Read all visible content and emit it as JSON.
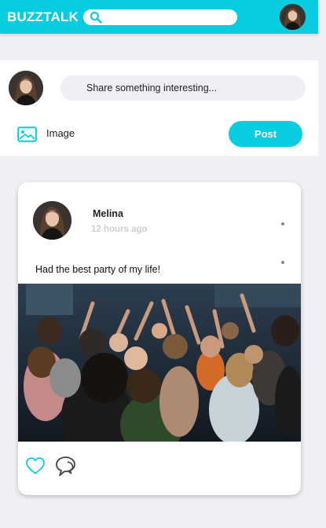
{
  "header": {
    "brand": "BUZZTALK",
    "search": {
      "value": "",
      "placeholder": ""
    },
    "icons": {
      "search": "search-icon",
      "avatar": "user-avatar"
    }
  },
  "composer": {
    "placeholder": "Share something interesting...",
    "image_label": "Image",
    "post_label": "Post"
  },
  "post": {
    "author": "Melina",
    "time": "12 hours ago",
    "text": "Had the best party of my life!",
    "photo": "crowd-party-photo",
    "actions": [
      "heart-icon",
      "comment-icon"
    ]
  },
  "colors": {
    "accent": "#08cde0",
    "background": "#eff0f3",
    "card": "#ffffff",
    "muted": "#cfcfcf"
  }
}
